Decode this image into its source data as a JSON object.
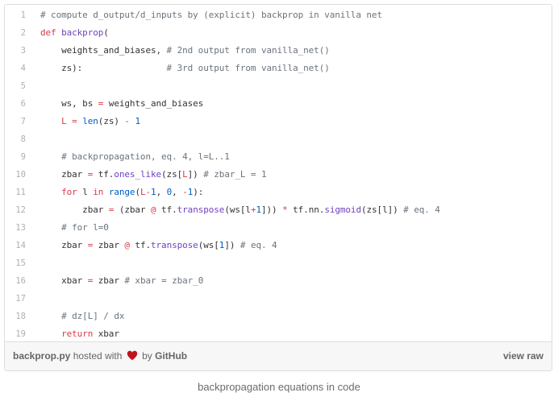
{
  "gist": {
    "lines": [
      {
        "n": "1",
        "tokens": [
          {
            "t": "# compute d_output/d_inputs by (explicit) backprop in vanilla net",
            "c": "com"
          }
        ]
      },
      {
        "n": "2",
        "tokens": [
          {
            "t": "def ",
            "c": "kw"
          },
          {
            "t": "backprop",
            "c": "fn"
          },
          {
            "t": "(",
            "c": "txt"
          }
        ]
      },
      {
        "n": "3",
        "tokens": [
          {
            "t": "    weights_and_biases, ",
            "c": "txt"
          },
          {
            "t": "# 2nd output from vanilla_net()",
            "c": "com"
          }
        ]
      },
      {
        "n": "4",
        "tokens": [
          {
            "t": "    zs):                ",
            "c": "txt"
          },
          {
            "t": "# 3rd output from vanilla_net()",
            "c": "com"
          }
        ]
      },
      {
        "n": "5",
        "tokens": []
      },
      {
        "n": "6",
        "tokens": [
          {
            "t": "    ws, bs ",
            "c": "txt"
          },
          {
            "t": "=",
            "c": "op"
          },
          {
            "t": " weights_and_biases",
            "c": "txt"
          }
        ]
      },
      {
        "n": "7",
        "tokens": [
          {
            "t": "    ",
            "c": "txt"
          },
          {
            "t": "L",
            "c": "kw"
          },
          {
            "t": " ",
            "c": "txt"
          },
          {
            "t": "=",
            "c": "op"
          },
          {
            "t": " ",
            "c": "txt"
          },
          {
            "t": "len",
            "c": "bi"
          },
          {
            "t": "(zs) ",
            "c": "txt"
          },
          {
            "t": "-",
            "c": "op"
          },
          {
            "t": " ",
            "c": "txt"
          },
          {
            "t": "1",
            "c": "num"
          }
        ]
      },
      {
        "n": "8",
        "tokens": []
      },
      {
        "n": "9",
        "tokens": [
          {
            "t": "    ",
            "c": "txt"
          },
          {
            "t": "# backpropagation, eq. 4, l=L..1",
            "c": "com"
          }
        ]
      },
      {
        "n": "10",
        "tokens": [
          {
            "t": "    zbar ",
            "c": "txt"
          },
          {
            "t": "=",
            "c": "op"
          },
          {
            "t": " tf.",
            "c": "txt"
          },
          {
            "t": "ones_like",
            "c": "fn"
          },
          {
            "t": "(zs[",
            "c": "txt"
          },
          {
            "t": "L",
            "c": "kw"
          },
          {
            "t": "]) ",
            "c": "txt"
          },
          {
            "t": "# zbar_L = 1",
            "c": "com"
          }
        ]
      },
      {
        "n": "11",
        "tokens": [
          {
            "t": "    ",
            "c": "txt"
          },
          {
            "t": "for",
            "c": "kw"
          },
          {
            "t": " l ",
            "c": "txt"
          },
          {
            "t": "in",
            "c": "kw"
          },
          {
            "t": " ",
            "c": "txt"
          },
          {
            "t": "range",
            "c": "bi"
          },
          {
            "t": "(",
            "c": "txt"
          },
          {
            "t": "L",
            "c": "kw"
          },
          {
            "t": "-",
            "c": "op"
          },
          {
            "t": "1",
            "c": "num"
          },
          {
            "t": ", ",
            "c": "txt"
          },
          {
            "t": "0",
            "c": "num"
          },
          {
            "t": ", ",
            "c": "txt"
          },
          {
            "t": "-",
            "c": "op"
          },
          {
            "t": "1",
            "c": "num"
          },
          {
            "t": "):",
            "c": "txt"
          }
        ]
      },
      {
        "n": "12",
        "tokens": [
          {
            "t": "        zbar ",
            "c": "txt"
          },
          {
            "t": "=",
            "c": "op"
          },
          {
            "t": " (zbar ",
            "c": "txt"
          },
          {
            "t": "@",
            "c": "op"
          },
          {
            "t": " tf.",
            "c": "txt"
          },
          {
            "t": "transpose",
            "c": "fn"
          },
          {
            "t": "(ws[l",
            "c": "txt"
          },
          {
            "t": "+",
            "c": "op"
          },
          {
            "t": "1",
            "c": "num"
          },
          {
            "t": "])) ",
            "c": "txt"
          },
          {
            "t": "*",
            "c": "op"
          },
          {
            "t": " tf.nn.",
            "c": "txt"
          },
          {
            "t": "sigmoid",
            "c": "fn"
          },
          {
            "t": "(zs[l]) ",
            "c": "txt"
          },
          {
            "t": "# eq. 4",
            "c": "com"
          }
        ]
      },
      {
        "n": "13",
        "tokens": [
          {
            "t": "    ",
            "c": "txt"
          },
          {
            "t": "# for l=0",
            "c": "com"
          }
        ]
      },
      {
        "n": "14",
        "tokens": [
          {
            "t": "    zbar ",
            "c": "txt"
          },
          {
            "t": "=",
            "c": "op"
          },
          {
            "t": " zbar ",
            "c": "txt"
          },
          {
            "t": "@",
            "c": "op"
          },
          {
            "t": " tf.",
            "c": "txt"
          },
          {
            "t": "transpose",
            "c": "fn"
          },
          {
            "t": "(ws[",
            "c": "txt"
          },
          {
            "t": "1",
            "c": "num"
          },
          {
            "t": "]) ",
            "c": "txt"
          },
          {
            "t": "# eq. 4",
            "c": "com"
          }
        ]
      },
      {
        "n": "15",
        "tokens": []
      },
      {
        "n": "16",
        "tokens": [
          {
            "t": "    xbar ",
            "c": "txt"
          },
          {
            "t": "=",
            "c": "op"
          },
          {
            "t": " zbar ",
            "c": "txt"
          },
          {
            "t": "# xbar = zbar_0",
            "c": "com"
          }
        ]
      },
      {
        "n": "17",
        "tokens": []
      },
      {
        "n": "18",
        "tokens": [
          {
            "t": "    ",
            "c": "txt"
          },
          {
            "t": "# dz[L] / dx",
            "c": "com"
          }
        ]
      },
      {
        "n": "19",
        "tokens": [
          {
            "t": "    ",
            "c": "txt"
          },
          {
            "t": "return",
            "c": "kw"
          },
          {
            "t": " xbar",
            "c": "txt"
          }
        ]
      }
    ],
    "footer": {
      "filename": "backprop.py",
      "hosted_with": "hosted with",
      "by": "by",
      "github": "GitHub",
      "view_raw": "view raw",
      "heart_icon": "heart-icon",
      "heart_color": "#c0131b"
    }
  },
  "caption": "backpropagation equations in code",
  "colors": {
    "comment": "#6a737d",
    "keyword": "#d73a49",
    "function": "#6f42c1",
    "builtin": "#005cc5",
    "text": "#333333"
  }
}
